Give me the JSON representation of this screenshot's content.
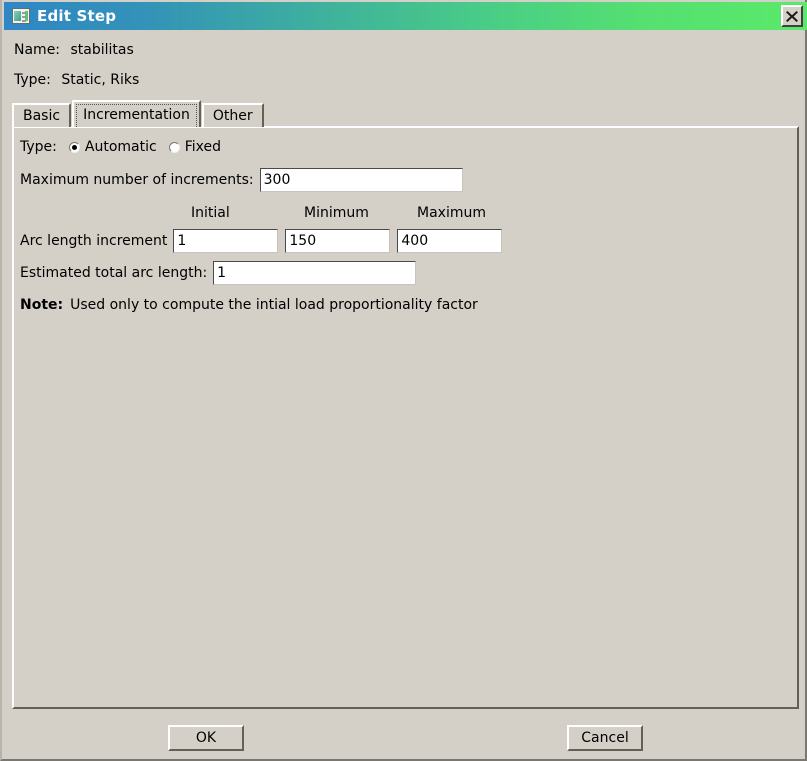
{
  "window": {
    "title": "Edit Step",
    "icon": "step-editor-icon",
    "close_label": "✕",
    "accent_start": "#2f86c4",
    "accent_end": "#5ae96a",
    "face_color": "#d4d0c8"
  },
  "header": {
    "name_label": "Name:",
    "name_value": "stabilitas",
    "type_label": "Type:",
    "type_value": "Static, Riks"
  },
  "tabs": [
    {
      "label": "Basic",
      "selected": false
    },
    {
      "label": "Incrementation",
      "selected": true
    },
    {
      "label": "Other",
      "selected": false
    }
  ],
  "incrementation": {
    "type_label": "Type:",
    "type_options": [
      {
        "label": "Automatic",
        "selected": true
      },
      {
        "label": "Fixed",
        "selected": false
      }
    ],
    "max_increments_label": "Maximum number of increments:",
    "max_increments_value": "300",
    "column_headers": {
      "initial": "Initial",
      "minimum": "Minimum",
      "maximum": "Maximum"
    },
    "arc_length_label": "Arc length increment",
    "arc_length_initial": "1",
    "arc_length_minimum": "150",
    "arc_length_maximum": "400",
    "estimated_total_label": "Estimated total arc length:",
    "estimated_total_value": "1",
    "note_prefix": "Note:",
    "note_text": "Used only to compute the intial load proportionality factor"
  },
  "footer": {
    "ok_label": "OK",
    "cancel_label": "Cancel"
  }
}
